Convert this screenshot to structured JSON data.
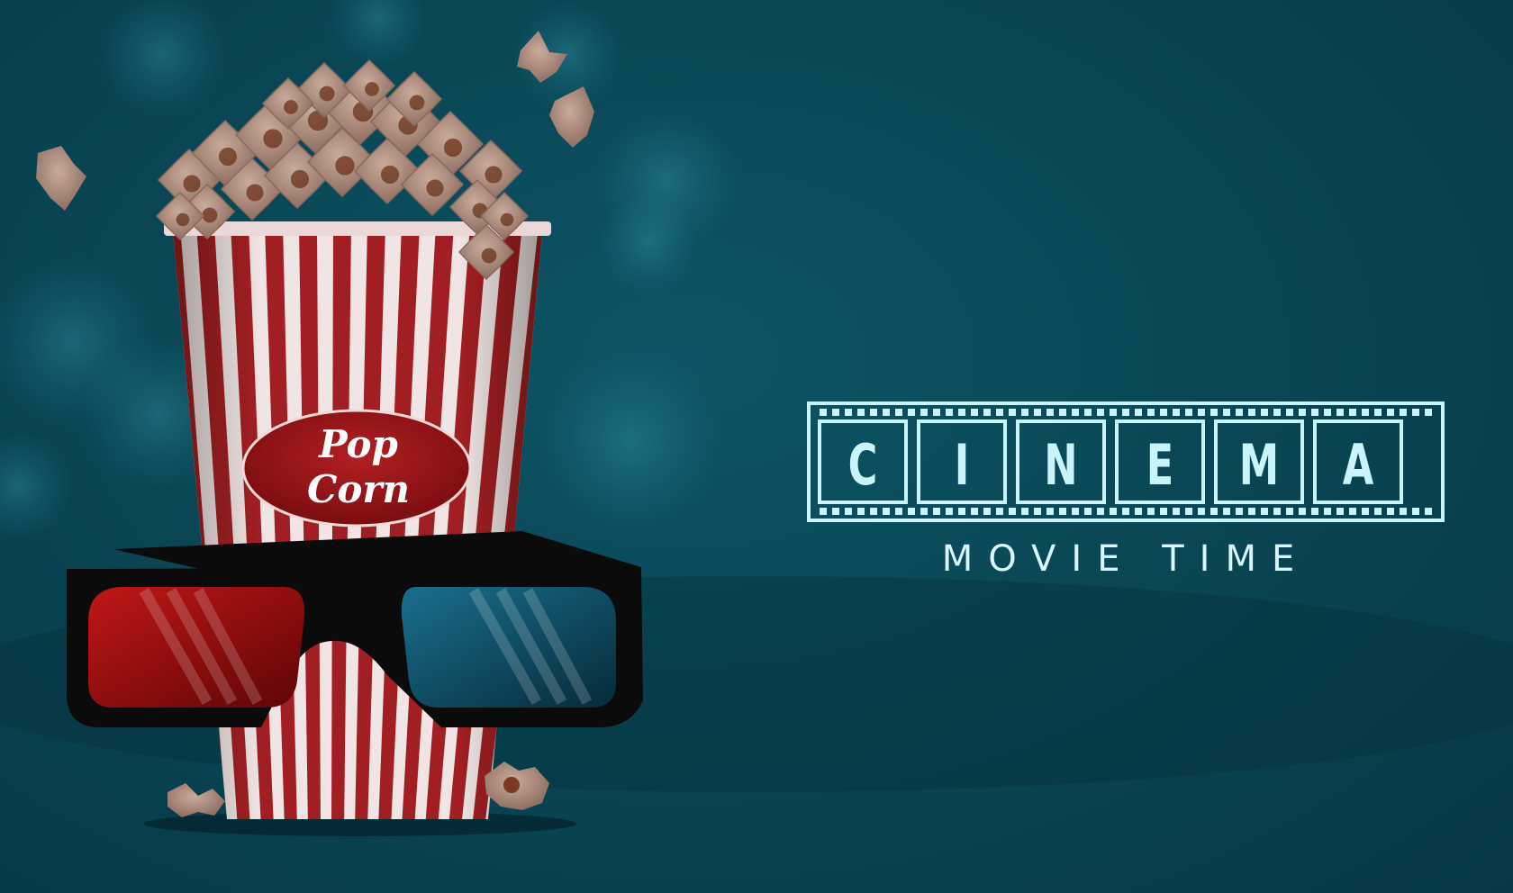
{
  "popcorn_label": {
    "line1": "Pop",
    "line2": "Corn"
  },
  "cinema_title": {
    "letters": [
      "C",
      "I",
      "N",
      "E",
      "M",
      "A"
    ]
  },
  "tagline": "MOVIE TIME",
  "colors": {
    "background": "#0a4756",
    "logo": "#c9f4fa",
    "stripe_red": "#a11f22",
    "stripe_white": "#f0e4e4",
    "popcorn": "#b89a8c",
    "lens_red": "#a01010",
    "lens_blue": "#0d5e7a",
    "glasses_frame": "#0b0b0b"
  }
}
